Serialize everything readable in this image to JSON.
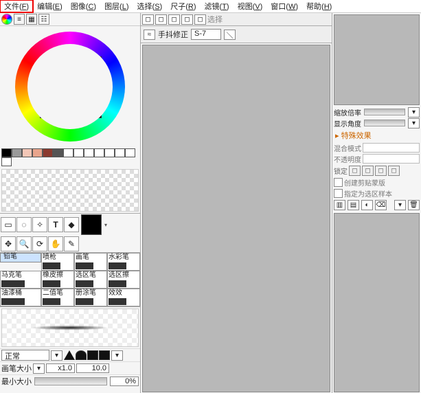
{
  "menu": [
    {
      "label": "文件(F)",
      "hl": true
    },
    {
      "label": "编辑(E)"
    },
    {
      "label": "图像(C)"
    },
    {
      "label": "图层(L)"
    },
    {
      "label": "选择(S)"
    },
    {
      "label": "尺子(R)"
    },
    {
      "label": "滤镜(T)"
    },
    {
      "label": "视图(V)"
    },
    {
      "label": "窗口(W)"
    },
    {
      "label": "帮助(H)"
    }
  ],
  "swatches": [
    "#000",
    "#999",
    "#f2c6b6",
    "#e8a48c",
    "#8b3a2f",
    "#555",
    "#fff",
    "#fff",
    "#fff",
    "#fff",
    "#fff",
    "#fff",
    "#fff",
    "#fff"
  ],
  "brushes": [
    {
      "name": "铅笔",
      "sel": true
    },
    {
      "name": "喷枪"
    },
    {
      "name": "画笔"
    },
    {
      "name": "水彩笔"
    },
    {
      "name": "马克笔"
    },
    {
      "name": "橡皮擦"
    },
    {
      "name": "选区笔"
    },
    {
      "name": "选区擦"
    },
    {
      "name": "油漆桶"
    },
    {
      "name": "二值笔"
    },
    {
      "name": "册涂笔"
    },
    {
      "name": "效效"
    }
  ],
  "mode_label": "正常",
  "size": {
    "label": "画笔大小",
    "mult": "x1.0",
    "val": "10.0"
  },
  "minsize": {
    "label": "最小大小",
    "val": "0%"
  },
  "mid": {
    "sel_label": "选择",
    "stab_label": "手抖修正",
    "stab_val": "S-7"
  },
  "right": {
    "zoom": "缩放倍率",
    "angle": "显示角度",
    "special": "▸ 特殊效果",
    "blend": "混合模式",
    "opacity": "不透明度",
    "lock": "锁定",
    "clip": "创建剪贴蒙版",
    "assel": "指定为选区样本"
  }
}
